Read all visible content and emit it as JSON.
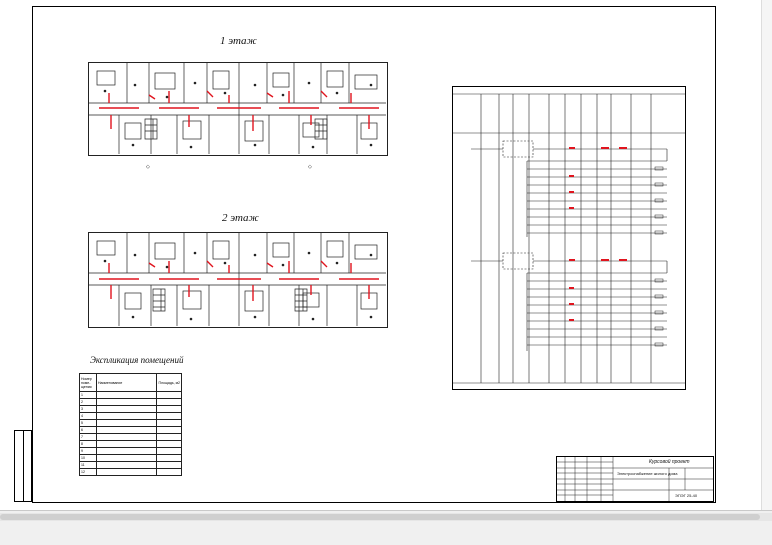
{
  "floor1_title": "1 этаж",
  "floor2_title": "2 этаж",
  "explication_title": "Экспликация помещений",
  "explication": {
    "headers": [
      "Номер поме-щения",
      "Наименование",
      "Площадь, м2"
    ],
    "rows": [
      [
        "1",
        "",
        ""
      ],
      [
        "2",
        "",
        ""
      ],
      [
        "3",
        "",
        ""
      ],
      [
        "4",
        "",
        ""
      ],
      [
        "5",
        "",
        ""
      ],
      [
        "6",
        "",
        ""
      ],
      [
        "7",
        "",
        ""
      ],
      [
        "8",
        "",
        ""
      ],
      [
        "9",
        "",
        ""
      ],
      [
        "10",
        "",
        ""
      ],
      [
        "11",
        "",
        ""
      ],
      [
        "12",
        "",
        ""
      ]
    ]
  },
  "schema_title": "Расчетная схема электрической осветительной сети",
  "stamp": {
    "project": "Курсовой проект",
    "sheet_name": "Электроснабжение жилого дома",
    "code": "ЭПЭГ 25-40"
  },
  "colors": {
    "accent_red": "#e0141e",
    "line": "#222222",
    "frame": "#000000"
  }
}
